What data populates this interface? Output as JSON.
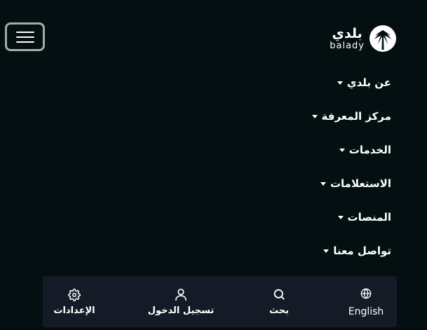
{
  "header": {
    "logo_ar": "بلدي",
    "logo_en": "balady",
    "menu_toggle_label": ""
  },
  "nav": {
    "items": [
      {
        "label": "عن بلدي"
      },
      {
        "label": "مركز المعرفة"
      },
      {
        "label": "الخدمات"
      },
      {
        "label": "الاستعلامات"
      },
      {
        "label": "المنصات"
      },
      {
        "label": "تواصل معنا"
      }
    ]
  },
  "bottom_bar": {
    "settings_label": "الإعدادات",
    "login_label": "تسجيل الدخول",
    "search_label": "بحث",
    "language_label": "English"
  },
  "colors": {
    "background": "#030f10",
    "bottom_bar": "#151b26",
    "toggle_border": "#a6aaad",
    "text": "#ffffff"
  },
  "icons": {
    "logo": "palm-tree-logo-icon",
    "settings": "gear-icon",
    "login": "user-icon",
    "search": "search-icon",
    "language": "globe-icon",
    "menu": "hamburger-icon"
  }
}
